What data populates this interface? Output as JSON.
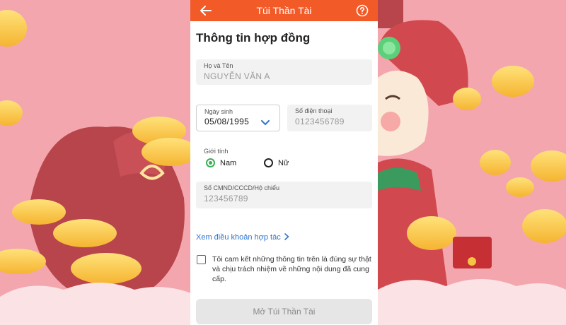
{
  "header": {
    "title": "Túi Thần Tài",
    "back_icon": "arrow-left-icon",
    "help_icon": "question-circle-icon"
  },
  "form": {
    "heading": "Thông tin hợp đồng",
    "full_name": {
      "label": "Họ và Tên",
      "placeholder": "NGUYỄN VĂN A"
    },
    "dob": {
      "label": "Ngày sinh",
      "value": "05/08/1995",
      "icon": "chevron-down-icon"
    },
    "phone": {
      "label": "Số điện thoại",
      "placeholder": "0123456789"
    },
    "gender": {
      "label": "Giới tính",
      "options": [
        "Nam",
        "Nữ"
      ],
      "selected": "Nam"
    },
    "id_number": {
      "label": "Số CMND/CCCD/Hộ chiếu",
      "placeholder": "123456789"
    },
    "terms_link": "Xem điều khoản hợp tác",
    "commitment": "Tôi cam kết những thông tin trên là đúng sự thật và chịu trách nhiệm về những nội dung đã cung cấp.",
    "submit_label": "Mở Túi Thần Tài"
  },
  "colors": {
    "header": "#f25a28",
    "accent_green": "#3cae5a",
    "link": "#2f74d0",
    "background": "#f3a6ad"
  }
}
